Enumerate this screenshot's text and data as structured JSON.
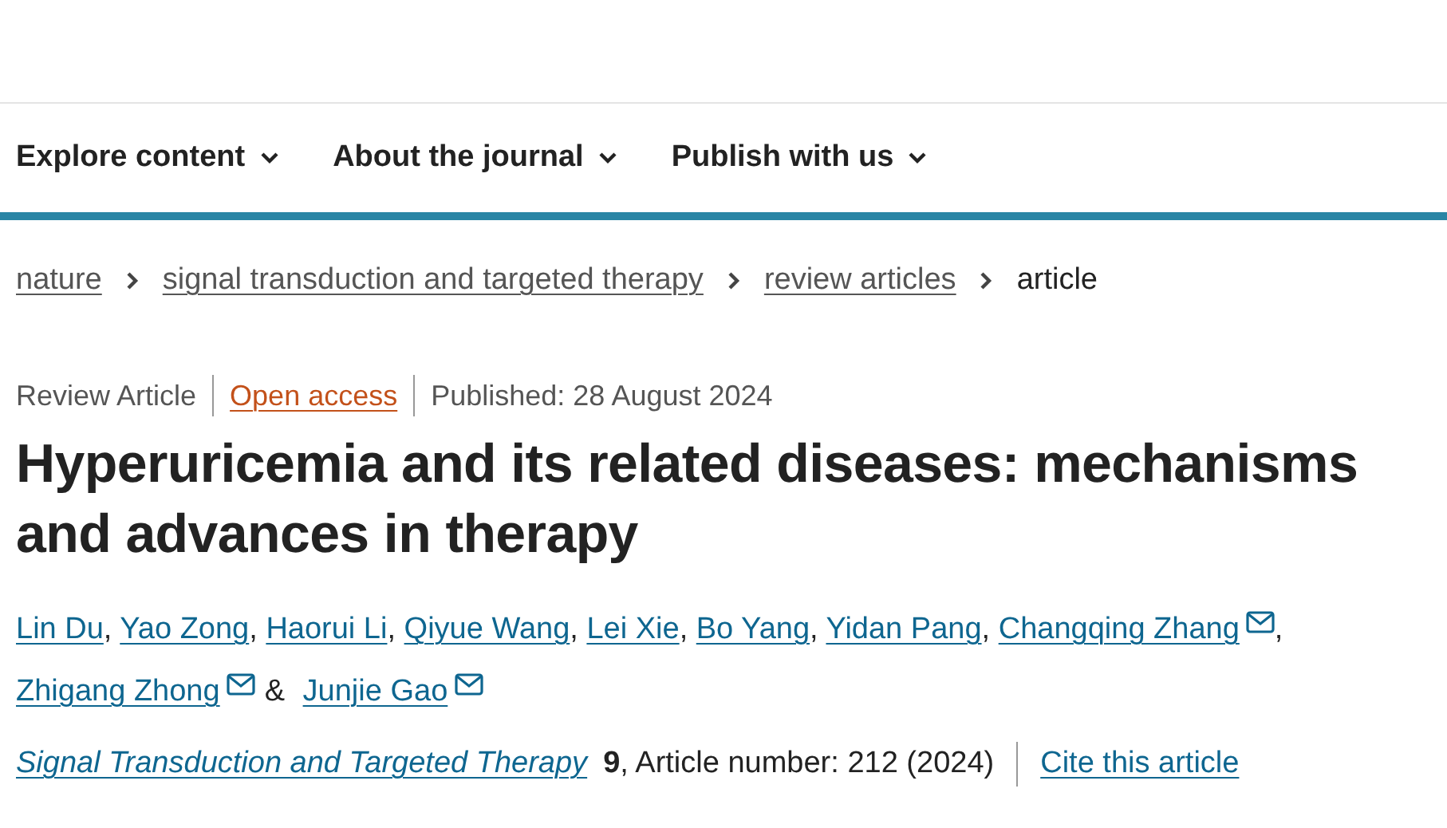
{
  "nav": {
    "items": [
      {
        "label": "Explore content",
        "expanded": false
      },
      {
        "label": "About the journal",
        "expanded": false
      },
      {
        "label": "Publish with us",
        "expanded": false
      }
    ]
  },
  "breadcrumbs": [
    {
      "label": "nature",
      "kind": "link"
    },
    {
      "label": "signal transduction and targeted therapy",
      "kind": "link"
    },
    {
      "label": "review articles",
      "kind": "link"
    },
    {
      "label": "article",
      "kind": "current"
    }
  ],
  "article": {
    "meta": [
      {
        "text": "Review Article",
        "kind": "type"
      },
      {
        "text": "Open access",
        "kind": "access"
      },
      {
        "text": "Published: 28 August 2024",
        "kind": "date"
      }
    ],
    "title": "Hyperuricemia and its related diseases: mechanisms and advances in therapy",
    "authors": [
      {
        "name": "Lin Du",
        "email": false,
        "separator": ","
      },
      {
        "name": "Yao Zong",
        "email": false,
        "separator": ","
      },
      {
        "name": "Haorui Li",
        "email": false,
        "separator": ","
      },
      {
        "name": "Qiyue Wang",
        "email": false,
        "separator": ","
      },
      {
        "name": "Lei Xie",
        "email": false,
        "separator": ","
      },
      {
        "name": "Bo Yang",
        "email": false,
        "separator": ","
      },
      {
        "name": "Yidan Pang",
        "email": false,
        "separator": ","
      },
      {
        "name": "Changqing Zhang",
        "email": true,
        "separator": ","
      },
      {
        "name": "Zhigang Zhong",
        "email": true,
        "separator": "&"
      },
      {
        "name": "Junjie Gao",
        "email": true
      }
    ],
    "citation": {
      "journal": "Signal Transduction and Targeted Therapy",
      "details": "**9**, Article number: 212 (2024)",
      "cite_link": "Cite this article"
    }
  }
}
